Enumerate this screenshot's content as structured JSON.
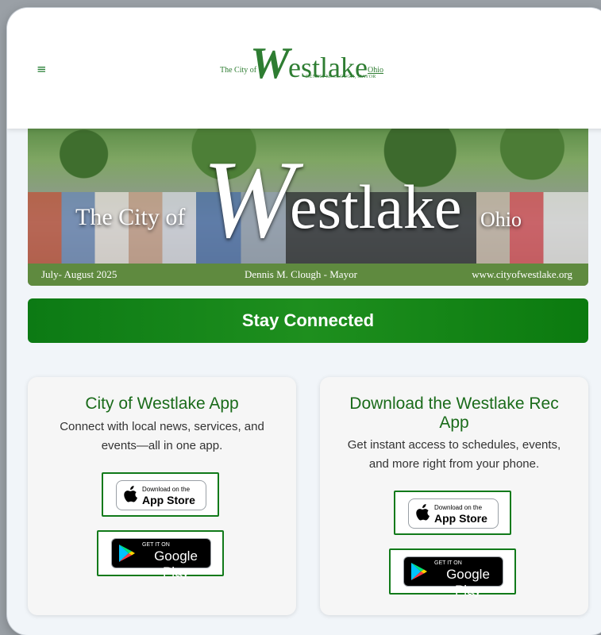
{
  "header": {
    "menu_icon": "hamburger-icon",
    "logo": {
      "pre": "The City of",
      "w": "W",
      "rest": "estlake",
      "post": "Ohio",
      "mayor": "DENNIS M. CLOUGH, MAYOR"
    }
  },
  "banner": {
    "title_pre": "The City of",
    "title_w": "W",
    "title_rest": "estlake",
    "title_post": "Ohio",
    "issue": "July- August 2025",
    "mayor": "Dennis M. Clough - Mayor",
    "website": "www.cityofwestlake.org"
  },
  "stay_connected": {
    "label": "Stay Connected"
  },
  "cards": [
    {
      "title": "City of Westlake App",
      "description": "Connect with local news, services, and events—all in one app.",
      "appstore": {
        "small": "Download on the",
        "big": "App Store"
      },
      "googleplay": {
        "small": "GET IT ON",
        "big": "Google Play"
      }
    },
    {
      "title": "Download the Westlake Rec App",
      "description": "Get instant access to schedules, events, and more right from your phone.",
      "appstore": {
        "small": "Download on the",
        "big": "App Store"
      },
      "googleplay": {
        "small": "GET IT ON",
        "big": "Google Play"
      }
    }
  ],
  "colors": {
    "accent": "#117a1a",
    "title_green": "#1a6b1a",
    "strip_green": "#5f8a3f"
  }
}
